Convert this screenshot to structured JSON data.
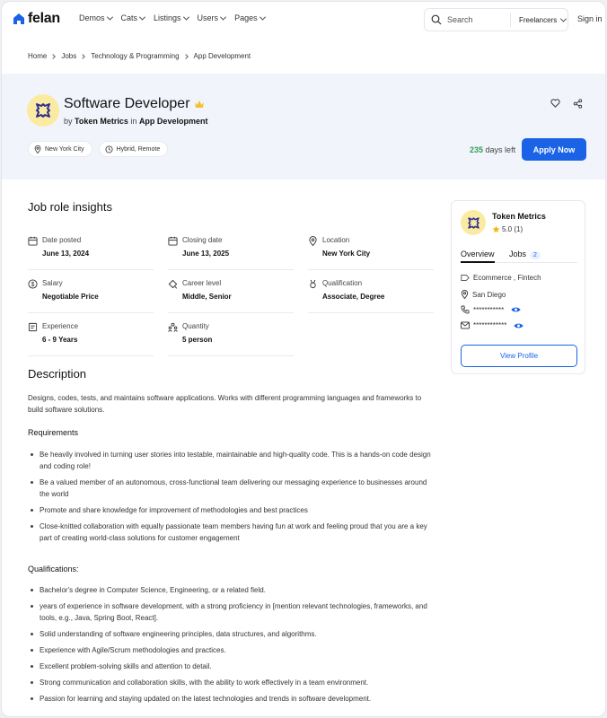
{
  "header": {
    "logo_text": "felan",
    "nav": [
      "Demos",
      "Cats",
      "Listings",
      "Users",
      "Pages"
    ],
    "search_placeholder": "Search",
    "search_category": "Freelancers",
    "signin_label": "Sign in"
  },
  "breadcrumb": [
    "Home",
    "Jobs",
    "Technology & Programming",
    "App Development"
  ],
  "job": {
    "title": "Software Developer",
    "by_prefix": "by",
    "company": "Token Metrics",
    "in_word": "in",
    "category": "App Development",
    "tags": [
      "New York City",
      "Hybrid, Remote"
    ],
    "days_left_number": "235",
    "days_left_suffix": "days left",
    "apply_label": "Apply Now"
  },
  "insights": {
    "title": "Job role insights",
    "items": [
      {
        "label": "Date posted",
        "value": "June 13, 2024",
        "icon": "calendar-icon"
      },
      {
        "label": "Closing date",
        "value": "June 13, 2025",
        "icon": "calendar-icon"
      },
      {
        "label": "Location",
        "value": "New York City",
        "icon": "map-pin-icon"
      },
      {
        "label": "Salary",
        "value": "Negotiable Price",
        "icon": "dollar-icon"
      },
      {
        "label": "Career level",
        "value": "Middle, Senior",
        "icon": "level-icon"
      },
      {
        "label": "Qualification",
        "value": "Associate, Degree",
        "icon": "medal-icon"
      },
      {
        "label": "Experience",
        "value": "6 - 9 Years",
        "icon": "experience-icon"
      },
      {
        "label": "Quantity",
        "value": "5 person",
        "icon": "people-icon"
      }
    ]
  },
  "description": {
    "title": "Description",
    "intro": "Designs, codes, tests, and maintains software applications. Works with different programming languages and frameworks to build software solutions.",
    "requirements_title": "Requirements",
    "requirements": [
      "Be heavily involved in turning user stories into testable, maintainable and high-quality code. This is a hands-on code design and coding role!",
      "Be a valued member of an autonomous, cross-functional team delivering our messaging experience to businesses around the world",
      "Promote and share knowledge for improvement of methodologies and best practices",
      "Close-knitted collaboration with equally passionate team members having fun at work and feeling proud that you are a key part of creating world-class solutions for customer engagement"
    ],
    "qualifications_title": "Qualifications:",
    "qualifications": [
      "Bachelor's degree in Computer Science, Engineering, or a related field.",
      "years of experience in software development, with a strong proficiency in [mention relevant technologies, frameworks, and tools, e.g., Java, Spring Boot, React].",
      "Solid understanding of software engineering principles, data structures, and algorithms.",
      "Experience with Agile/Scrum methodologies and practices.",
      "Excellent problem-solving skills and attention to detail.",
      "Strong communication and collaboration skills, with the ability to work effectively in a team environment.",
      "Passion for learning and staying updated on the latest technologies and trends in software development."
    ]
  },
  "company_card": {
    "name": "Token Metrics",
    "rating": "5.0 (1)",
    "tab_overview": "Overview",
    "tab_jobs": "Jobs",
    "jobs_count": "2",
    "industry": "Ecommerce , Fintech",
    "location": "San Diego",
    "phone_masked": "***********",
    "email_masked": "************",
    "view_profile_label": "View Profile"
  },
  "colors": {
    "accent": "#1a63e6",
    "hero_bg": "#f1f5fb",
    "days_green": "#2e9d5b",
    "logo_bg": "#fbeaa2",
    "logo_mark": "#2b2f8f"
  }
}
